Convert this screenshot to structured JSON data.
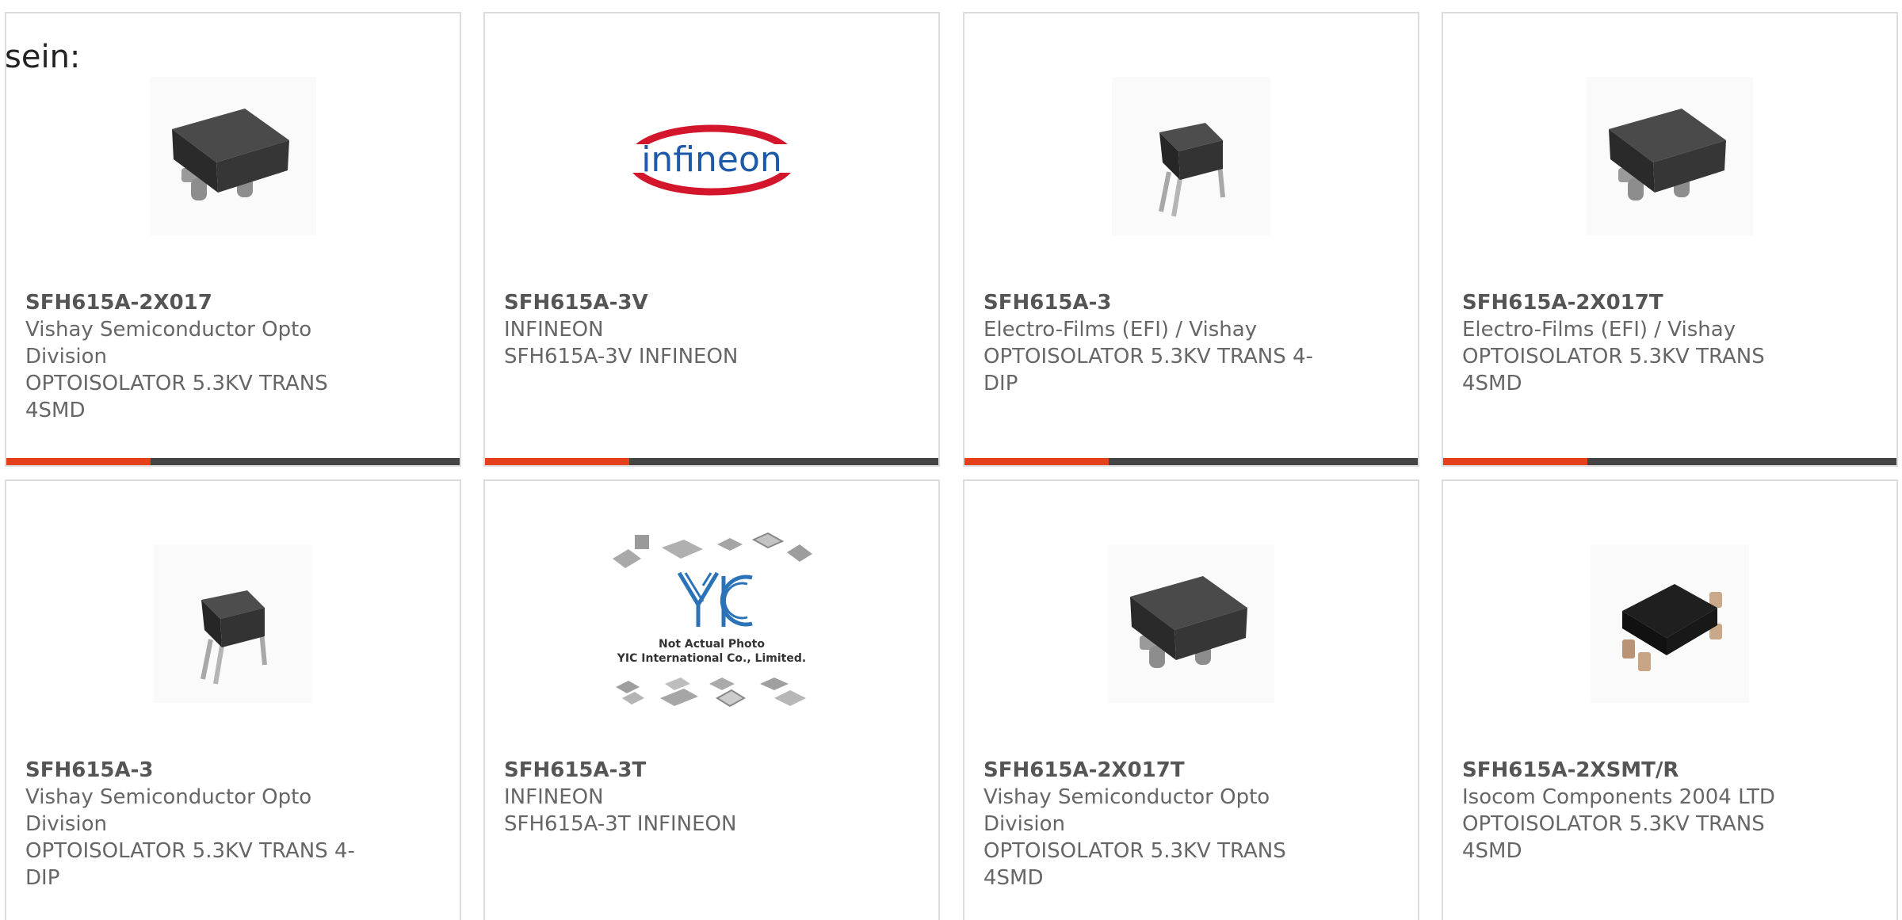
{
  "prefix_text": "sein:",
  "colors": {
    "accent": "#e5401c",
    "bar": "#444444",
    "border": "#dcdcdc",
    "text": "#666666"
  },
  "products": [
    {
      "part_number": "SFH615A-2X017",
      "manufacturer": "Vishay Semiconductor Opto Division",
      "description": "OPTOISOLATOR 5.3KV TRANS 4SMD",
      "image": "smd-optocoupler-image"
    },
    {
      "part_number": "SFH615A-3V",
      "manufacturer": "INFINEON",
      "description": "SFH615A-3V INFINEON",
      "image": "infineon-logo",
      "logo_text": "infineon"
    },
    {
      "part_number": "SFH615A-3",
      "manufacturer": "Electro-Films (EFI) / Vishay",
      "description": "OPTOISOLATOR 5.3KV TRANS 4-DIP",
      "image": "dip-optocoupler-image"
    },
    {
      "part_number": "SFH615A-2X017T",
      "manufacturer": "Electro-Films (EFI) / Vishay",
      "description": "OPTOISOLATOR 5.3KV TRANS 4SMD",
      "image": "smd-optocoupler-image"
    },
    {
      "part_number": "SFH615A-3",
      "manufacturer": "Vishay Semiconductor Opto Division",
      "description": "OPTOISOLATOR 5.3KV TRANS 4-DIP",
      "image": "dip-optocoupler-image"
    },
    {
      "part_number": "SFH615A-3T",
      "manufacturer": "INFINEON",
      "description": "SFH615A-3T INFINEON",
      "image": "yic-placeholder-image",
      "placeholder_text_1": "Not Actual Photo",
      "placeholder_text_2": "YIC International Co., Limited.",
      "placeholder_logo": "YIC"
    },
    {
      "part_number": "SFH615A-2X017T",
      "manufacturer": "Vishay Semiconductor Opto Division",
      "description": "OPTOISOLATOR 5.3KV TRANS 4SMD",
      "image": "smd-optocoupler-image"
    },
    {
      "part_number": "SFH615A-2XSMT/R",
      "manufacturer": "Isocom Components 2004 LTD",
      "description": "OPTOISOLATOR 5.3KV TRANS 4SMD",
      "image": "isocom-smd-image"
    }
  ]
}
